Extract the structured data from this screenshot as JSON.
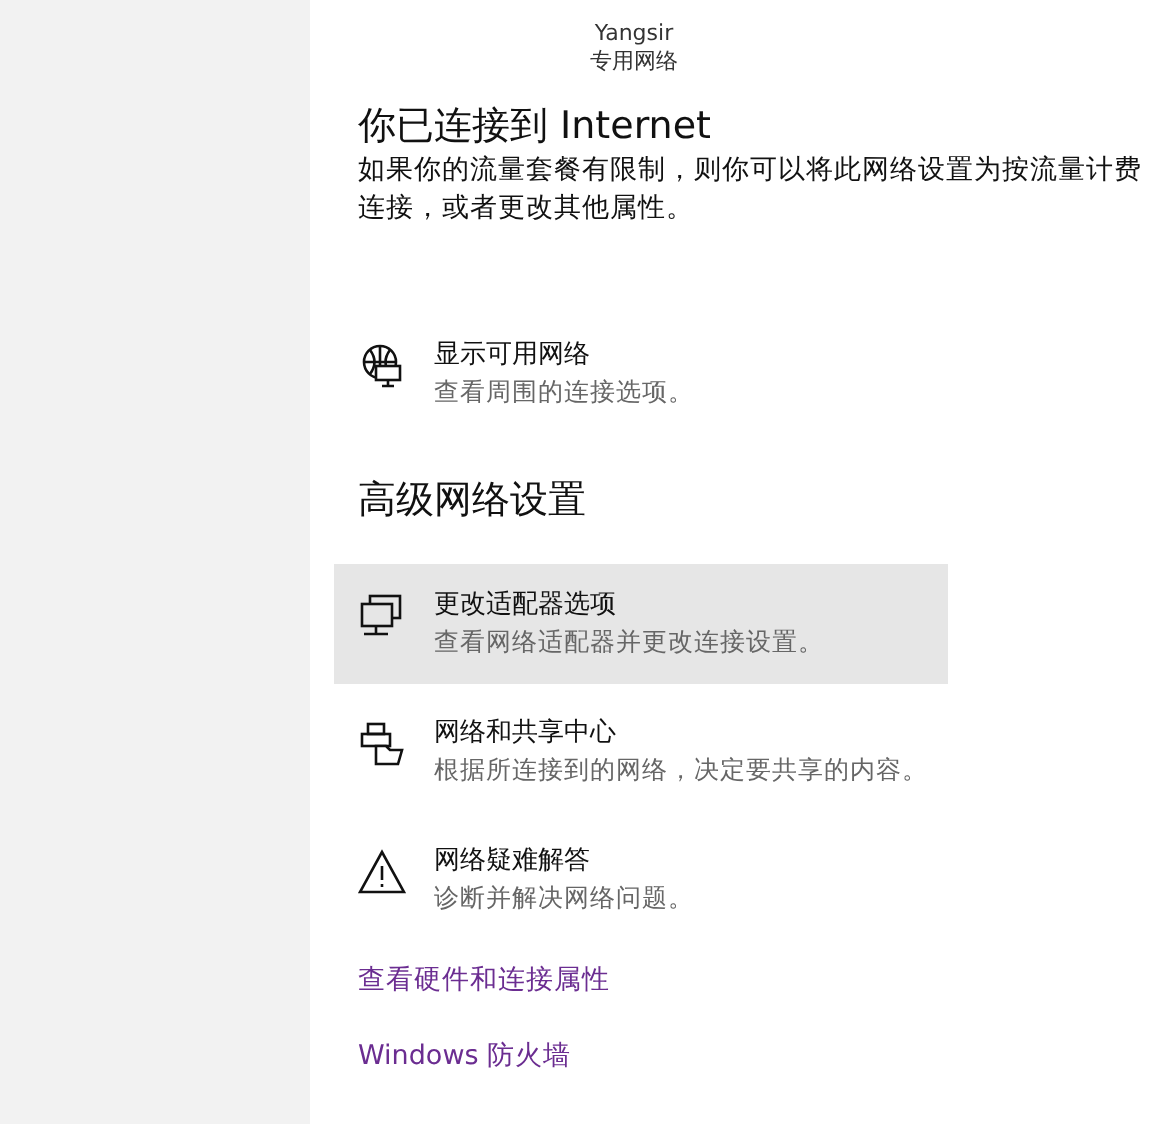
{
  "network": {
    "name": "Yangsir",
    "type": "专用网络"
  },
  "status": {
    "title": "你已连接到 Internet",
    "lines": [
      "如果你的流量套餐有限制，则你可以将此网络设置为按流量计费",
      "连接，或者更改其他属性。"
    ]
  },
  "show_networks": {
    "kind": "globe",
    "title": "显示可用网络",
    "subtitle": "查看周围的连接选项。",
    "selected": false
  },
  "advanced": {
    "title": "高级网络设置",
    "items": [
      {
        "kind": "adapter",
        "title": "更改适配器选项",
        "subtitle": "查看网络适配器并更改连接设置。",
        "selected": true
      },
      {
        "kind": "sharing",
        "title": "网络和共享中心",
        "subtitle": "根据所连接到的网络，决定要共享的内容。",
        "selected": false
      },
      {
        "kind": "warning",
        "title": "网络疑难解答",
        "subtitle": "诊断并解决网络问题。",
        "selected": false
      }
    ]
  },
  "links": [
    "查看硬件和连接属性",
    "Windows 防火墙"
  ]
}
